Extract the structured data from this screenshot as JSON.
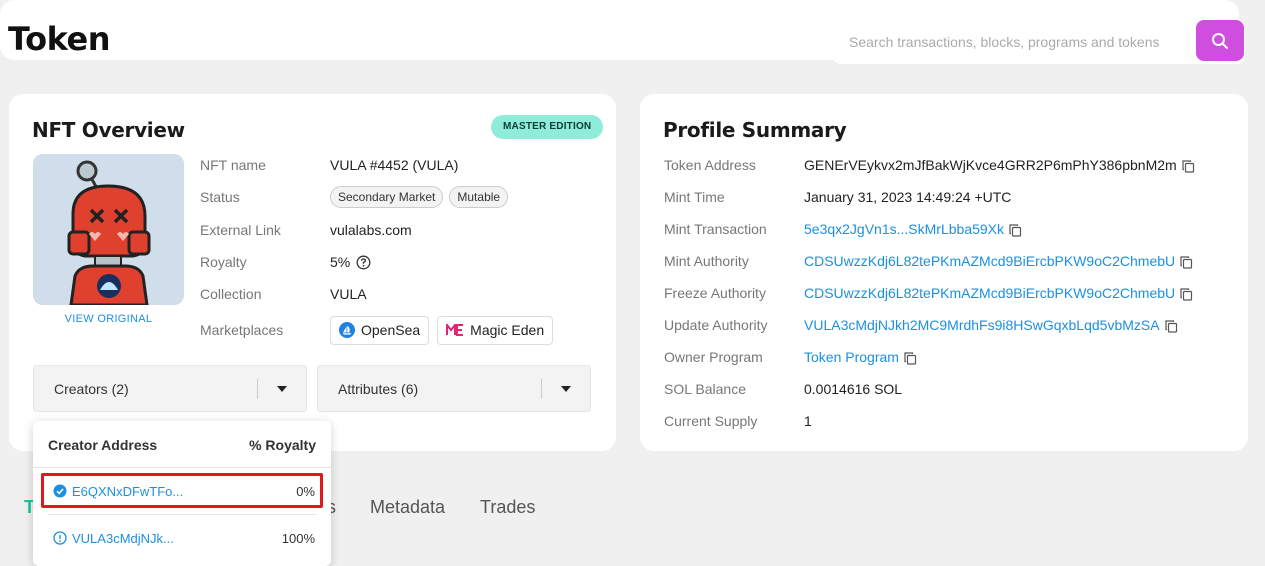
{
  "page": {
    "title": "Token"
  },
  "search": {
    "placeholder": "Search transactions, blocks, programs and tokens"
  },
  "nft_overview": {
    "title": "NFT Overview",
    "badge": "MASTER EDITION",
    "view_original": "VIEW ORIGINAL",
    "fields": {
      "nft_name": {
        "label": "NFT name",
        "value": "VULA #4452 (VULA)"
      },
      "status": {
        "label": "Status",
        "tags": [
          "Secondary Market",
          "Mutable"
        ]
      },
      "external_link": {
        "label": "External Link",
        "value": "vulalabs.com"
      },
      "royalty": {
        "label": "Royalty",
        "value": "5%"
      },
      "collection": {
        "label": "Collection",
        "value": "VULA"
      },
      "marketplaces": {
        "label": "Marketplaces",
        "items": [
          "OpenSea",
          "Magic Eden"
        ]
      }
    },
    "creators_dropdown": "Creators (2)",
    "attributes_dropdown": "Attributes (6)"
  },
  "creators_popover": {
    "col_address": "Creator Address",
    "col_royalty": "% Royalty",
    "rows": [
      {
        "address": "E6QXNxDFwTFo...",
        "royalty": "0%",
        "verified": true
      },
      {
        "address": "VULA3cMdjNJk...",
        "royalty": "100%",
        "verified": false
      }
    ]
  },
  "profile_summary": {
    "title": "Profile Summary",
    "rows": [
      {
        "label": "Token Address",
        "value": "GENErVEykvx2mJfBakWjKvce4GRR2P6mPhY386pbnM2m"
      },
      {
        "label": "Mint Time",
        "value": "January 31, 2023 14:49:24 +UTC"
      },
      {
        "label": "Mint Transaction",
        "value": "5e3qx2JgVn1s...SkMrLbba59Xk"
      },
      {
        "label": "Mint Authority",
        "value": "CDSUwzzKdj6L82tePKmAZMcd9BiErcbPKW9oC2ChmebU"
      },
      {
        "label": "Freeze Authority",
        "value": "CDSUwzzKdj6L82tePKmAZMcd9BiErcbPKW9oC2ChmebU"
      },
      {
        "label": "Update Authority",
        "value": "VULA3cMdjNJkh2MC9MrdhFs9i8HSwGqxbLqd5vbMzSA"
      },
      {
        "label": "Owner Program",
        "value": "Token Program"
      },
      {
        "label": "SOL Balance",
        "value": "0.0014616 SOL"
      },
      {
        "label": "Current Supply",
        "value": "1"
      }
    ]
  },
  "tabs": [
    "T",
    "s",
    "Metadata",
    "Trades"
  ],
  "colors": {
    "accent": "#cf4ee0",
    "link": "#1d8fe0",
    "badge": "#8fecd9",
    "active_tab": "#14c8a0"
  }
}
